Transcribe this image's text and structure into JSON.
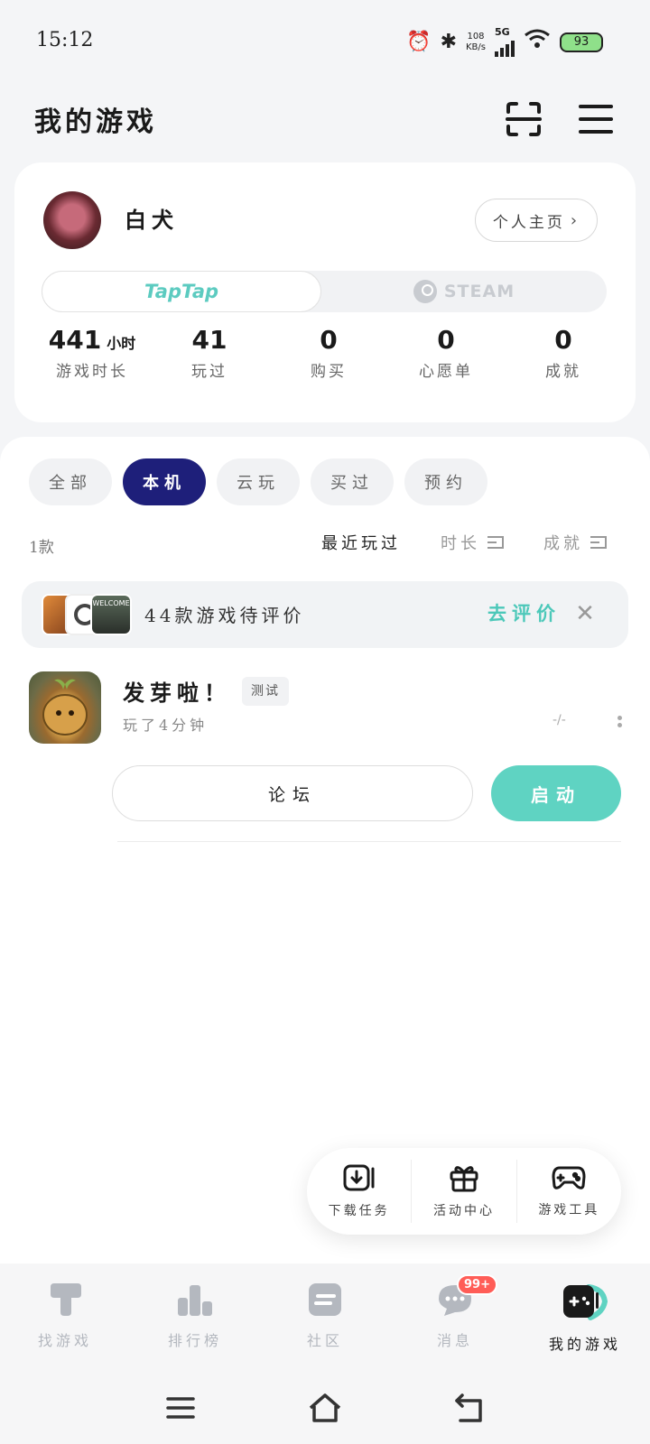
{
  "status_bar": {
    "time": "15:12",
    "net_speed_value": "108",
    "net_speed_unit": "KB/s",
    "network": "5G",
    "battery": "93"
  },
  "header": {
    "title": "我的游戏",
    "scan_icon": "scan-icon",
    "menu_icon": "hamburger-menu-icon"
  },
  "profile": {
    "username": "白犬",
    "homepage_label": "个人主页",
    "platforms": {
      "taptap": "TapTap",
      "steam": "STEAM",
      "active": "taptap"
    },
    "stats": [
      {
        "value": "441",
        "unit": "小时",
        "label": "游戏时长"
      },
      {
        "value": "41",
        "unit": "",
        "label": "玩过"
      },
      {
        "value": "0",
        "unit": "",
        "label": "购买"
      },
      {
        "value": "0",
        "unit": "",
        "label": "心愿单"
      },
      {
        "value": "0",
        "unit": "",
        "label": "成就"
      }
    ]
  },
  "filters": {
    "chips": [
      "全部",
      "本机",
      "云玩",
      "买过",
      "预约"
    ],
    "active_index": 1
  },
  "list_meta": {
    "count": "1款",
    "sort": [
      "最近玩过",
      "时长",
      "成就"
    ]
  },
  "review_banner": {
    "text": "44款游戏待评价",
    "action": "去评价",
    "thumb_text": "WELCOME"
  },
  "game": {
    "title": "发芽啦！",
    "tag": "测试",
    "playtime": "玩了4分钟",
    "rating": "-/-",
    "forum_label": "论坛",
    "launch_label": "启动"
  },
  "tools": [
    {
      "label": "下载任务",
      "icon": "download-icon"
    },
    {
      "label": "活动中心",
      "icon": "gift-icon"
    },
    {
      "label": "游戏工具",
      "icon": "gamepad-icon"
    }
  ],
  "bottom_nav": [
    {
      "label": "找游戏",
      "icon": "taptap-logo-icon"
    },
    {
      "label": "排行榜",
      "icon": "ranking-icon"
    },
    {
      "label": "社区",
      "icon": "community-icon"
    },
    {
      "label": "消息",
      "icon": "message-icon",
      "badge": "99+"
    },
    {
      "label": "我的游戏",
      "icon": "my-games-icon",
      "active": true
    }
  ],
  "colors": {
    "accent_teal": "#5fd3c2",
    "active_chip": "#1e1f7a",
    "badge_red": "#ff5d57"
  }
}
